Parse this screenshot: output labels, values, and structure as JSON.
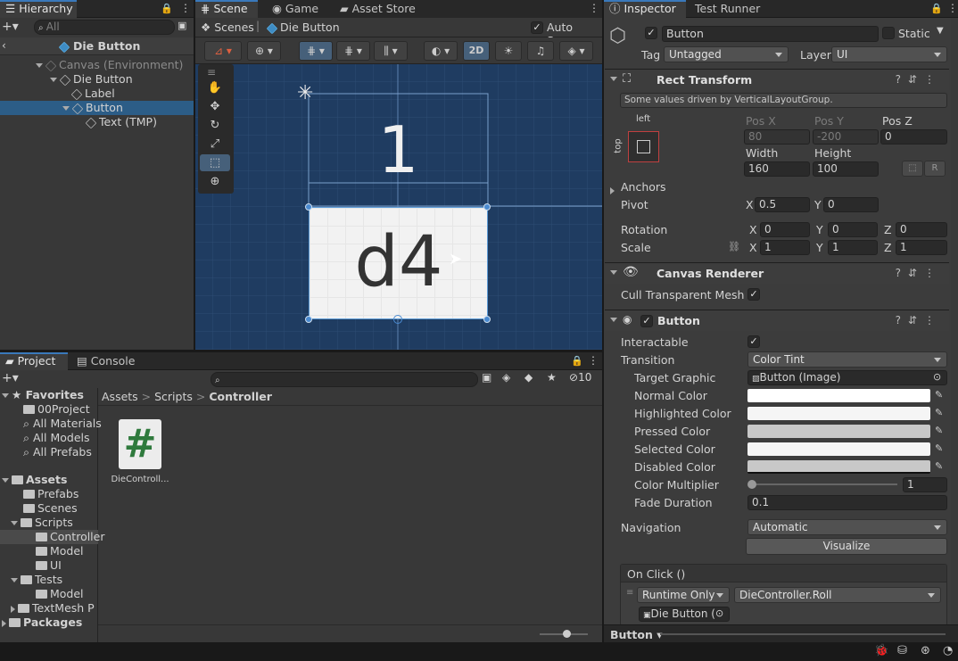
{
  "hierarchy": {
    "tab": "Hierarchy",
    "search_placeholder": "All",
    "scene_title": "Die Button",
    "items": [
      {
        "label": "Canvas (Environment)"
      },
      {
        "label": "Die Button"
      },
      {
        "label": "Label"
      },
      {
        "label": "Button"
      },
      {
        "label": "Text (TMP)"
      }
    ]
  },
  "scene_tabs": {
    "scene": "Scene",
    "game": "Game",
    "asset_store": "Asset Store"
  },
  "breadcrumb": {
    "scenes": "Scenes",
    "prefab": "Die Button"
  },
  "auto_save": "Auto Save",
  "toolbar": {
    "two_d": "2D"
  },
  "scene_view": {
    "label_text": "1",
    "button_text": "d4"
  },
  "project": {
    "tab": "Project",
    "console_tab": "Console",
    "hidden_count": "10",
    "breadcrumb": [
      "Assets",
      "Scripts",
      "Controller"
    ],
    "favorites_label": "Favorites",
    "favorites": [
      "00Project",
      "All Materials",
      "All Models",
      "All Prefabs"
    ],
    "assets_label": "Assets",
    "tree": [
      {
        "label": "Prefabs"
      },
      {
        "label": "Scenes"
      },
      {
        "label": "Scripts"
      },
      {
        "label": "Controller"
      },
      {
        "label": "Model"
      },
      {
        "label": "UI"
      },
      {
        "label": "Tests"
      },
      {
        "label": "Model"
      },
      {
        "label": "TextMesh P"
      }
    ],
    "packages_label": "Packages",
    "file": {
      "name": "DieControll...",
      "icon": "#"
    }
  },
  "inspector": {
    "tab": "Inspector",
    "test_runner_tab": "Test Runner",
    "object_name": "Button",
    "static_label": "Static",
    "tag_label": "Tag",
    "tag_value": "Untagged",
    "layer_label": "Layer",
    "layer_value": "UI",
    "rect_transform": {
      "title": "Rect Transform",
      "note": "Some values driven by VerticalLayoutGroup.",
      "anchor_left": "left",
      "anchor_top": "top",
      "pos_x_label": "Pos X",
      "pos_y_label": "Pos Y",
      "pos_z_label": "Pos Z",
      "pos_x": "80",
      "pos_y": "-200",
      "pos_z": "0",
      "width_label": "Width",
      "height_label": "Height",
      "width": "160",
      "height": "100",
      "r_button": "R",
      "anchors_label": "Anchors",
      "pivot_label": "Pivot",
      "pivot_x": "0.5",
      "pivot_y": "0",
      "rotation_label": "Rotation",
      "rot_x": "0",
      "rot_y": "0",
      "rot_z": "0",
      "scale_label": "Scale",
      "scale_x": "1",
      "scale_y": "1",
      "scale_z": "1",
      "x": "X",
      "y": "Y",
      "z": "Z"
    },
    "canvas_renderer": {
      "title": "Canvas Renderer",
      "cull_label": "Cull Transparent Mesh"
    },
    "button": {
      "title": "Button",
      "interactable_label": "Interactable",
      "transition_label": "Transition",
      "transition_value": "Color Tint",
      "target_graphic_label": "Target Graphic",
      "target_graphic_value": "Button (Image)",
      "colors": [
        {
          "label": "Normal Color",
          "color": "#ffffff"
        },
        {
          "label": "Highlighted Color",
          "color": "#f5f5f5"
        },
        {
          "label": "Pressed Color",
          "color": "#c8c8c8"
        },
        {
          "label": "Selected Color",
          "color": "#f5f5f5"
        },
        {
          "label": "Disabled Color",
          "color": "#c8c8c8"
        }
      ],
      "multiplier_label": "Color Multiplier",
      "multiplier_value": "1",
      "fade_label": "Fade Duration",
      "fade_value": "0.1",
      "navigation_label": "Navigation",
      "navigation_value": "Automatic",
      "visualize_label": "Visualize",
      "onclick_label": "On Click ()",
      "runtime_value": "Runtime Only",
      "function_value": "DieController.Roll",
      "object_value": "Die Button ("
    },
    "footer_label": "Button"
  },
  "colors": {
    "accent": "#3a79bb",
    "selection": "#2c5d87",
    "scene_bg": "#1f3c61"
  }
}
